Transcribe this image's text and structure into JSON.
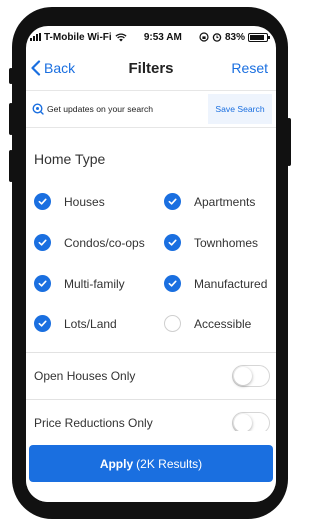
{
  "status_bar": {
    "carrier": "T-Mobile Wi-Fi",
    "time": "9:53 AM",
    "battery": "83%",
    "icons": [
      "signal-icon",
      "wifi-icon",
      "lock-rotation-icon",
      "alarm-icon",
      "battery-icon"
    ]
  },
  "nav": {
    "back_label": "Back",
    "title": "Filters",
    "reset_label": "Reset"
  },
  "updates": {
    "text": "Get updates on your search",
    "save_label": "Save Search"
  },
  "home_type": {
    "title": "Home Type",
    "options": [
      {
        "label": "Houses",
        "checked": true
      },
      {
        "label": "Apartments",
        "checked": true
      },
      {
        "label": "Condos/co-ops",
        "checked": true
      },
      {
        "label": "Townhomes",
        "checked": true
      },
      {
        "label": "Multi-family",
        "checked": true
      },
      {
        "label": "Manufactured",
        "checked": true
      },
      {
        "label": "Lots/Land",
        "checked": true
      },
      {
        "label": "Accessible",
        "checked": false
      }
    ]
  },
  "toggles": [
    {
      "label": "Open Houses Only",
      "on": false
    },
    {
      "label": "Price Reductions Only",
      "on": false
    }
  ],
  "apply": {
    "label": "Apply",
    "results": "(2K Results)"
  },
  "colors": {
    "accent": "#1a6fe0",
    "save_bg": "#eef4fd"
  }
}
